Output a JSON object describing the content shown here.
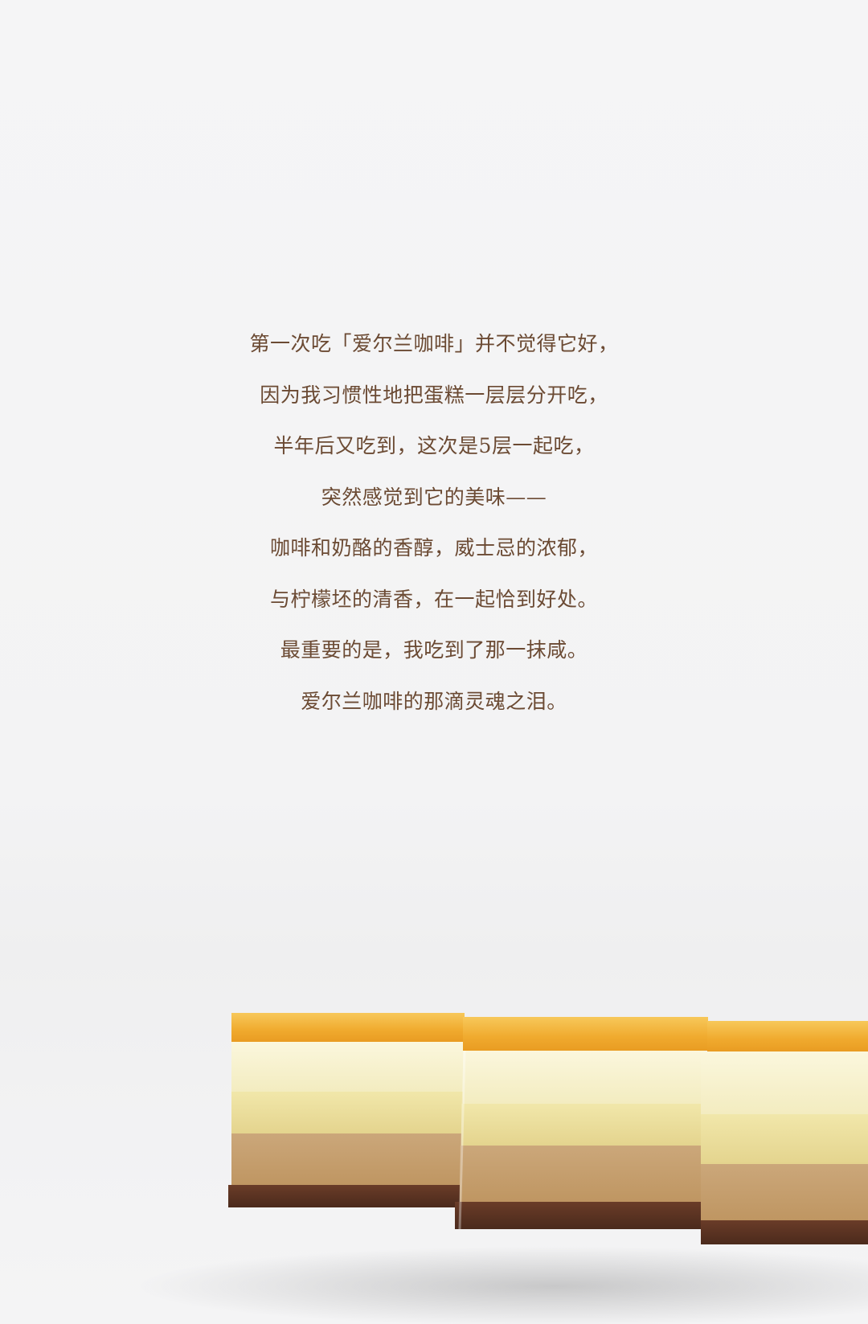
{
  "poem": {
    "lines": [
      "第一次吃「爱尔兰咖啡」并不觉得它好，",
      "因为我习惯性地把蛋糕一层层分开吃，",
      "半年后又吃到，这次是5层一起吃，",
      "突然感觉到它的美味——",
      "咖啡和奶酪的香醇，威士忌的浓郁，",
      "与柠檬坯的清香，在一起恰到好处。",
      "最重要的是，我吃到了那一抹咸。",
      "爱尔兰咖啡的那滴灵魂之泪。"
    ]
  },
  "colors": {
    "background": "#f4f4f5",
    "text": "#6b4a33",
    "jelly": "#f2b233",
    "cream": "#f6f0c8",
    "sponge": "#efe3a6",
    "coffee_mousse": "#c9a471",
    "cookie_base": "#5a3322"
  }
}
